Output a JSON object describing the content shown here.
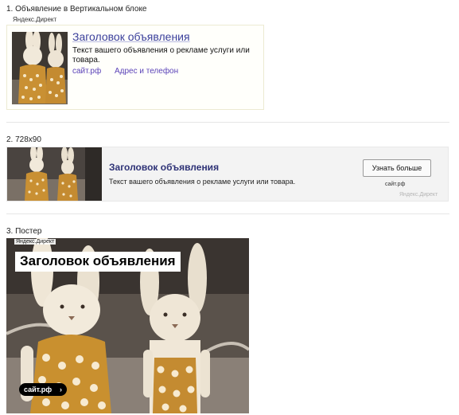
{
  "sections": {
    "vertical": {
      "heading": "1. Объявление в Вертикальном блоке",
      "source": "Яндекс.Директ",
      "title": "Заголовок объявления",
      "text": "Текст вашего объявления о рекламе услуги или товара.",
      "domain": "сайт.рф",
      "contacts": "Адрес и телефон"
    },
    "banner": {
      "heading": "2. 728x90",
      "title": "Заголовок объявления",
      "text": "Текст вашего объявления о рекламе услуги или товара.",
      "button": "Узнать больше",
      "domain": "сайт.рф",
      "source": "Яндекс.Директ"
    },
    "poster": {
      "heading": "3. Постер",
      "source": "Яндекс.Директ",
      "title": "Заголовок объявления",
      "domain": "сайт.рф",
      "arrow": "›"
    }
  },
  "colors": {
    "title_link": "#3a3f9b",
    "meta_link": "#5b43b8",
    "banner_bg": "#f3f3f3"
  }
}
